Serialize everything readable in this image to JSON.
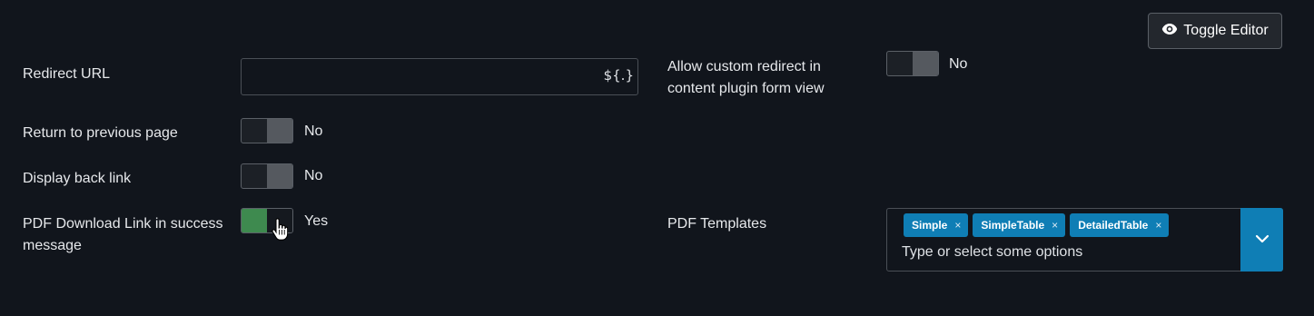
{
  "toolbar": {
    "toggle_editor_label": "Toggle Editor"
  },
  "fields": {
    "redirect_url": {
      "label": "Redirect URL",
      "value": "",
      "var_button": "${.}"
    },
    "return_previous": {
      "label": "Return to previous page",
      "state": "No",
      "on": false
    },
    "display_back_link": {
      "label": "Display back link",
      "state": "No",
      "on": false
    },
    "pdf_download_link": {
      "label_line1": "PDF Download Link in success",
      "label_line2": "message",
      "state": "Yes",
      "on": true
    },
    "allow_custom_redirect": {
      "label_line1": "Allow custom redirect in",
      "label_line2": "content plugin form view",
      "state": "No",
      "on": false
    },
    "pdf_templates": {
      "label": "PDF Templates",
      "selected": [
        "Simple",
        "SimpleTable",
        "DetailedTable"
      ],
      "remove_glyph": "×",
      "placeholder": "Type or select some options"
    }
  },
  "colors": {
    "background": "#11151c",
    "switch_on": "#3e8a4f",
    "accent": "#0f7eb5"
  },
  "icons": {
    "toggle_editor": "eye-icon",
    "dropdown": "chevron-down-icon",
    "cursor": "hand-pointer-icon"
  }
}
